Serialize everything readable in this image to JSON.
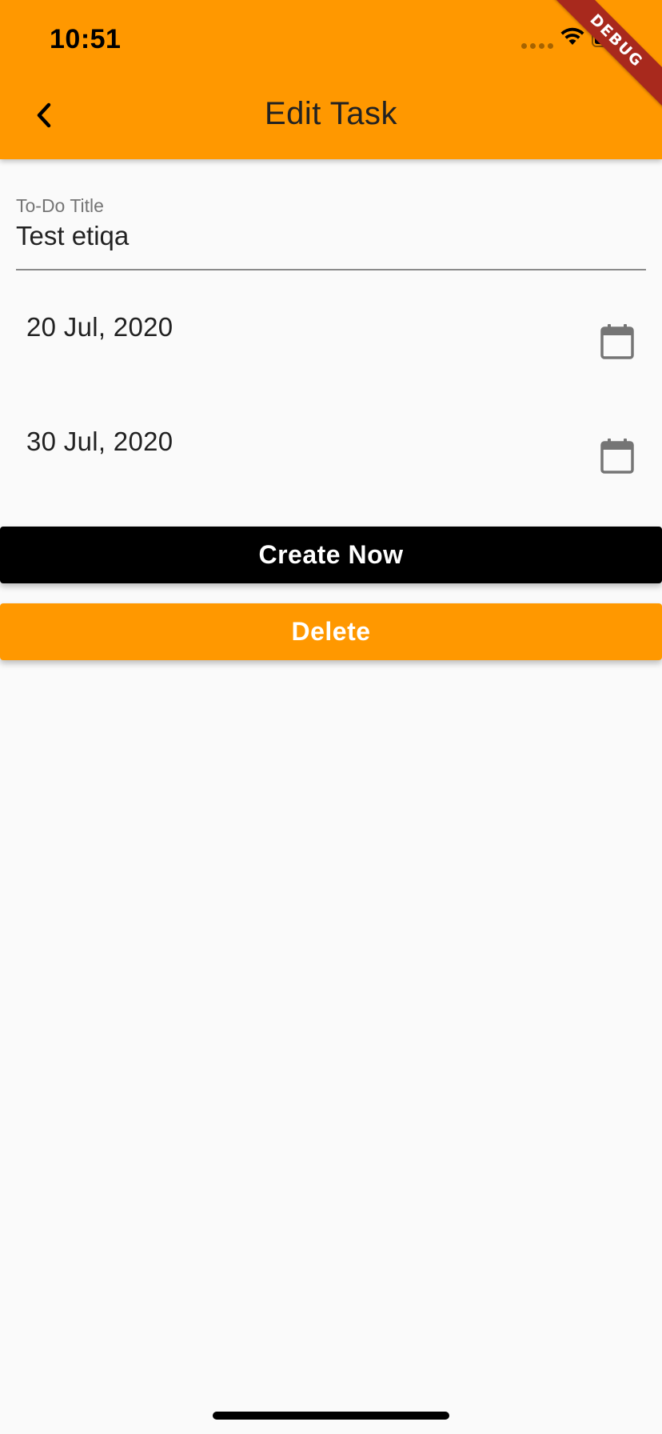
{
  "status_bar": {
    "time": "10:51",
    "icons": [
      "signal-dots-icon",
      "wifi-icon",
      "battery-icon"
    ]
  },
  "debug_banner": "DEBUG",
  "appbar": {
    "title": "Edit Task",
    "back_icon": "chevron-left-icon"
  },
  "form": {
    "title_field": {
      "label": "To-Do Title",
      "value": "Test etiqa"
    },
    "start_date": {
      "value": "20 Jul, 2020",
      "icon": "calendar-icon"
    },
    "end_date": {
      "value": "30 Jul, 2020",
      "icon": "calendar-icon"
    }
  },
  "buttons": {
    "create_label": "Create Now",
    "delete_label": "Delete"
  },
  "colors": {
    "accent": "#ff9800",
    "create_button": "#000000",
    "debug_ribbon": "#a8291d",
    "background": "#fafafa"
  }
}
